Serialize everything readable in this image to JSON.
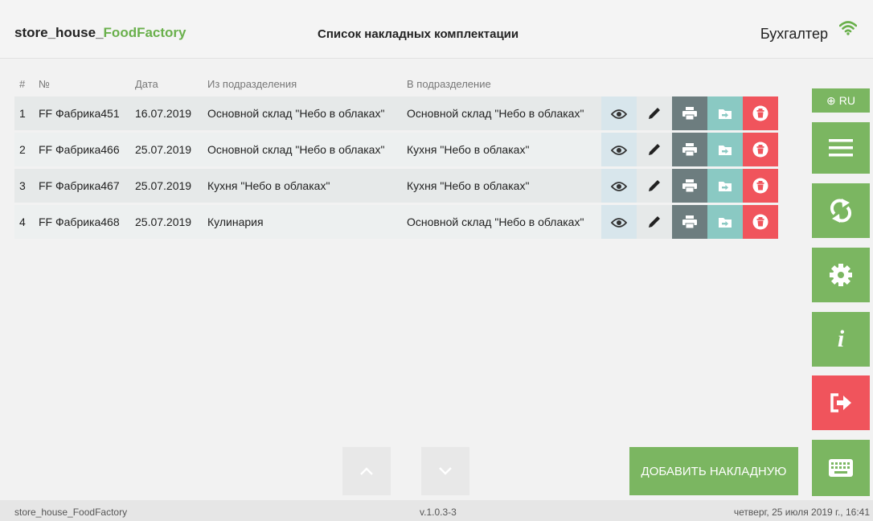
{
  "header": {
    "brand_prefix": "store_house_",
    "brand_suffix": "FoodFactory",
    "title": "Список накладных комплектации",
    "user": "Бухгалтер"
  },
  "table": {
    "columns": [
      "#",
      "№",
      "Дата",
      "Из подразделения",
      "В подразделение"
    ],
    "rows": [
      {
        "num": "1",
        "doc": "FF Фабрика451",
        "date": "16.07.2019",
        "from": "Основной склад \"Небо в облаках\"",
        "to": "Основной склад \"Небо в облаках\""
      },
      {
        "num": "2",
        "doc": "FF Фабрика466",
        "date": "25.07.2019",
        "from": "Основной склад \"Небо в облаках\"",
        "to": "Кухня \"Небо в облаках\""
      },
      {
        "num": "3",
        "doc": "FF Фабрика467",
        "date": "25.07.2019",
        "from": "Кухня \"Небо в облаках\"",
        "to": "Кухня \"Небо в облаках\""
      },
      {
        "num": "4",
        "doc": "FF Фабрика468",
        "date": "25.07.2019",
        "from": "Кулинария",
        "to": "Основной склад \"Небо в облаках\""
      }
    ],
    "row_actions": [
      "eye-icon",
      "pencil-icon",
      "printer-icon",
      "folder-move-icon",
      "trash-icon"
    ]
  },
  "sidebar": {
    "lang": "RU",
    "buttons": [
      "menu-icon",
      "sync-icon",
      "gear-icon",
      "info-icon",
      "logout-icon",
      "keyboard-icon"
    ]
  },
  "footer": {
    "add_button": "ДОБАВИТЬ НАКЛАДНУЮ"
  },
  "status": {
    "app": "store_house_FoodFactory",
    "version": "v.1.0.3-3",
    "datetime": "четверг, 25 июля 2019 г., 16:41"
  },
  "colors": {
    "accent_green": "#7bb661",
    "danger_red": "#f0545c",
    "print_gray": "#6d7d7f",
    "move_teal": "#8ac9c3"
  }
}
